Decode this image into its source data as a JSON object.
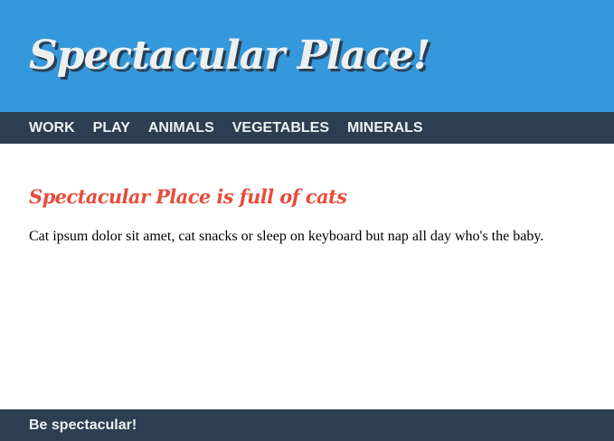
{
  "header": {
    "site_title": "Spectacular Place!"
  },
  "nav": {
    "items": [
      {
        "label": "WORK"
      },
      {
        "label": "PLAY"
      },
      {
        "label": "ANIMALS"
      },
      {
        "label": "VEGETABLES"
      },
      {
        "label": "MINERALS"
      }
    ]
  },
  "main": {
    "heading": "Spectacular Place is full of cats",
    "body": "Cat ipsum dolor sit amet, cat snacks or sleep on keyboard but nap all day who's the baby."
  },
  "footer": {
    "text": "Be spectacular!"
  },
  "colors": {
    "header_bg": "#3498db",
    "nav_bg": "#2c3e50",
    "heading_accent": "#e74c3c",
    "light_text": "#ecf0f1"
  }
}
